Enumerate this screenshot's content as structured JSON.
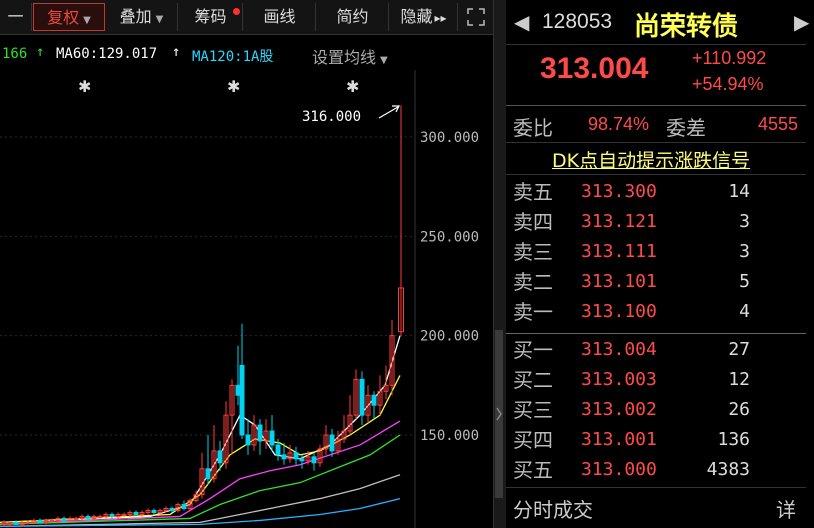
{
  "toolbar": {
    "items": [
      {
        "label": "一"
      },
      {
        "label": "复权"
      },
      {
        "label": "叠加"
      },
      {
        "label": "筹码"
      },
      {
        "label": "画线"
      },
      {
        "label": "简约"
      },
      {
        "label": "隐藏"
      }
    ],
    "hide_arrows": "▸▸",
    "expand_icon": "fullscreen-icon"
  },
  "ma_line": {
    "ma_prev": "166",
    "ma60": "MA60:129.017",
    "ma120": "MA120:1A股",
    "settings": "设置均线"
  },
  "chart": {
    "y_ticks": [
      "300.000",
      "250.000",
      "200.000",
      "150.000"
    ],
    "annotation": "316.000",
    "markers": [
      "✱",
      "✱",
      "✱"
    ],
    "colors": {
      "up": "#ff3b3b",
      "down": "#00d2f0",
      "ma1": "#ffffff",
      "ma2": "#ffff40",
      "ma3": "#ff40ff",
      "ma4": "#30e030",
      "ma5": "#c0c0c0",
      "ma6": "#2ab0ff"
    }
  },
  "quote": {
    "code": "128053",
    "name": "尚荣转债",
    "price": "313.004",
    "change": "+110.992",
    "change_pct": "+54.94%"
  },
  "commission": {
    "ratio_label": "委比",
    "ratio_value": "98.74%",
    "diff_label": "委差",
    "diff_value": "4555"
  },
  "dk_signal": "DK点自动提示涨跌信号",
  "asks": [
    {
      "label": "卖五",
      "price": "313.300",
      "volume": "14"
    },
    {
      "label": "卖四",
      "price": "313.121",
      "volume": "3"
    },
    {
      "label": "卖三",
      "price": "313.111",
      "volume": "3"
    },
    {
      "label": "卖二",
      "price": "313.101",
      "volume": "5"
    },
    {
      "label": "卖一",
      "price": "313.100",
      "volume": "4"
    }
  ],
  "bids": [
    {
      "label": "买一",
      "price": "313.004",
      "volume": "27"
    },
    {
      "label": "买二",
      "price": "313.003",
      "volume": "12"
    },
    {
      "label": "买三",
      "price": "313.002",
      "volume": "26"
    },
    {
      "label": "买四",
      "price": "313.001",
      "volume": "136"
    },
    {
      "label": "买五",
      "price": "313.000",
      "volume": "4383"
    }
  ],
  "footer": {
    "tick_label": "分时成交",
    "detail_label": "详"
  }
}
